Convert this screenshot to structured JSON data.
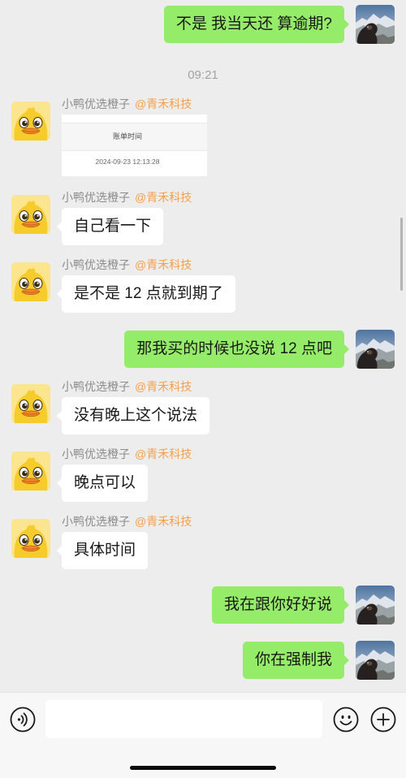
{
  "colors": {
    "chat_background": "#ededed",
    "outgoing_bubble": "#95ec69",
    "incoming_bubble": "#ffffff",
    "message_text": "#191919",
    "sender_name": "#8c8c8c",
    "sender_tag": "#f6a04b",
    "timestamp": "#a3a3a3",
    "composer_background": "#f7f7f7"
  },
  "timestamp": "09:21",
  "messages": [
    {
      "text": "不是 我当天还 算逾期?"
    },
    {
      "sender": "小鸭优选橙子",
      "sender_tag": "@青禾科技",
      "card": {
        "label": "账单时间",
        "value": "2024-09-23 12:13:28"
      }
    },
    {
      "sender": "小鸭优选橙子",
      "sender_tag": "@青禾科技",
      "text": "自己看一下"
    },
    {
      "sender": "小鸭优选橙子",
      "sender_tag": "@青禾科技",
      "text": "是不是 12 点就到期了"
    },
    {
      "text": "那我买的时候也没说 12 点吧"
    },
    {
      "sender": "小鸭优选橙子",
      "sender_tag": "@青禾科技",
      "text": "没有晚上这个说法"
    },
    {
      "sender": "小鸭优选橙子",
      "sender_tag": "@青禾科技",
      "text": "晚点可以"
    },
    {
      "sender": "小鸭优选橙子",
      "sender_tag": "@青禾科技",
      "text": "具体时间"
    },
    {
      "text": "我在跟你好好说"
    },
    {
      "text": "你在强制我"
    }
  ],
  "composer": {
    "input_value": "",
    "icons": {
      "voice": "voice-icon",
      "emoji": "emoji-icon",
      "plus": "plus-icon"
    }
  }
}
